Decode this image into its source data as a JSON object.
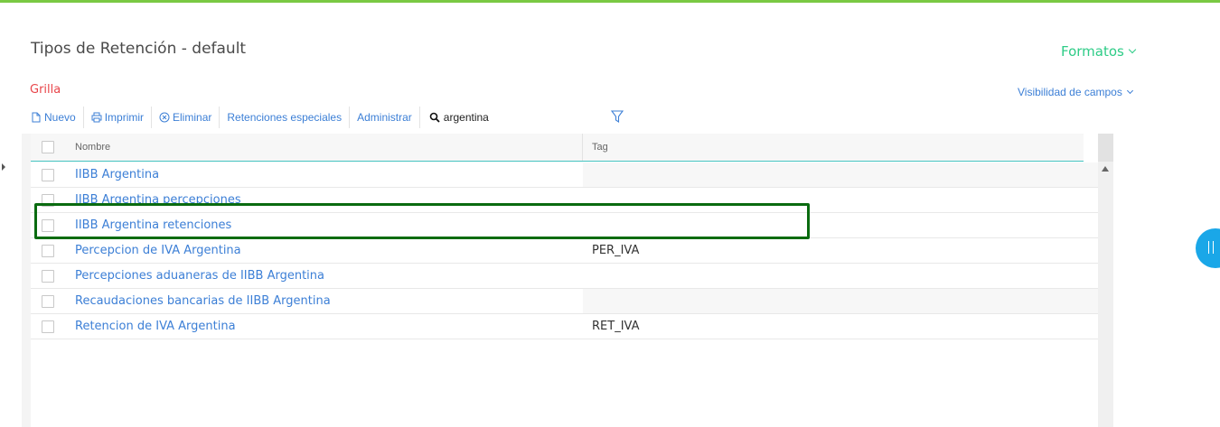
{
  "page": {
    "title": "Tipos de Retención - default",
    "formatos_label": "Formatos",
    "section_label": "Grilla",
    "visibilidad_label": "Visibilidad de campos"
  },
  "toolbar": {
    "nuevo": "Nuevo",
    "imprimir": "Imprimir",
    "eliminar": "Eliminar",
    "retenciones_especiales": "Retenciones especiales",
    "administrar": "Administrar",
    "search_value": "argentina"
  },
  "grid": {
    "columns": {
      "nombre": "Nombre",
      "tag": "Tag"
    },
    "rows": [
      {
        "nombre": "IIBB Argentina",
        "tag": ""
      },
      {
        "nombre": "IIBB Argentina percepciones",
        "tag": ""
      },
      {
        "nombre": "IIBB Argentina retenciones",
        "tag": ""
      },
      {
        "nombre": "Percepcion de IVA Argentina",
        "tag": "PER_IVA"
      },
      {
        "nombre": "Percepciones aduaneras de IIBB Argentina",
        "tag": ""
      },
      {
        "nombre": "Recaudaciones bancarias de IIBB Argentina",
        "tag": ""
      },
      {
        "nombre": "Retencion de IVA Argentina",
        "tag": "RET_IVA"
      }
    ]
  },
  "colors": {
    "accent_green": "#2ecc87",
    "link_blue": "#3c7fd6",
    "section_red": "#e8454a",
    "highlight_green": "#0a6b10",
    "toggle_blue": "#1aa7e8"
  }
}
